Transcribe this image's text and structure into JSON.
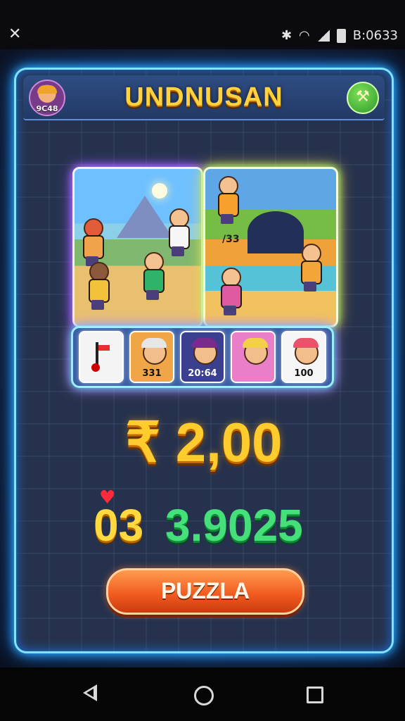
{
  "status_bar": {
    "time": "B:0633",
    "left_icon": "close-x-icon"
  },
  "game": {
    "title": "UNDNUSAN",
    "player_level": "9C48",
    "settings_icon": "hammer-icon",
    "puzzle": {
      "right_piece_label": "/33"
    },
    "tray_tiles": [
      {
        "icon": "flag-icon",
        "label": ""
      },
      {
        "icon": "character-cap",
        "label": "331"
      },
      {
        "icon": "character-beanie",
        "label": "20:64"
      },
      {
        "icon": "character-straw-hat",
        "label": ""
      },
      {
        "icon": "character-knit-hat",
        "label": "100"
      }
    ],
    "price": "₹ 2,00",
    "score_left": "03",
    "score_right": "3.9025",
    "play_button": "PUZZLA",
    "colors": {
      "frame_glow": "#7fe3ff",
      "title": "#ffd23e",
      "score_right": "#46e07a",
      "button": "#f0581e"
    }
  }
}
